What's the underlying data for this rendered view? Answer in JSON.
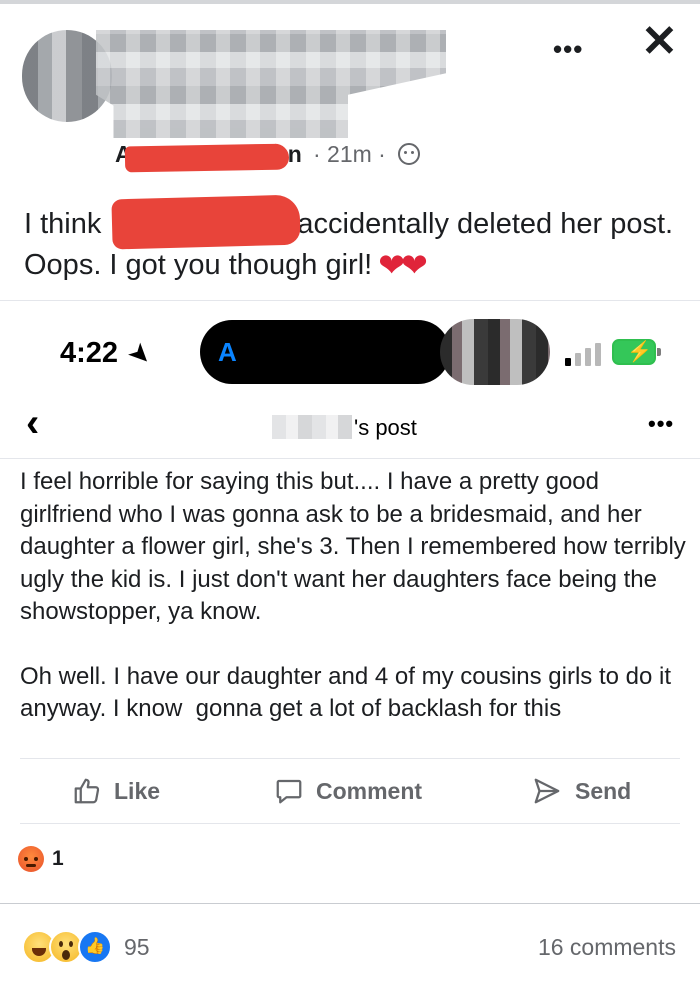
{
  "header": {
    "menu_icon": "more-horizontal-icon",
    "close_icon": "close-icon",
    "author_initial": "A",
    "author_suffix": "an",
    "time": "· 21m ·",
    "privacy_icon": "globe-icon"
  },
  "caption": {
    "before": "I think",
    "after": " accidentally deleted her post. Oops. I got you though girl!",
    "emoji": "❤❤"
  },
  "phone": {
    "time": "4:22",
    "nav_indicator": "A"
  },
  "shared_post": {
    "title_suffix": "'s post",
    "paragraphs": [
      "I feel horrible for saying this but.... I have a pretty good girlfriend who I was gonna ask to be a bridesmaid, and her daughter a flower girl, she's 3. Then I remembered how terribly ugly the kid is. I just don't want her daughters face being the showstopper, ya know.",
      "Oh well. I have our daughter and 4 of my cousins girls to do it anyway. I know  gonna get a lot of backlash for this"
    ],
    "actions": {
      "like": "Like",
      "comment": "Comment",
      "send": "Send"
    },
    "angry_count": "1"
  },
  "footer": {
    "reaction_count": "95",
    "comments": "16 comments"
  },
  "colors": {
    "redaction": "#e8443a",
    "facebook_blue": "#1877f2",
    "muted_text": "#65676b"
  }
}
